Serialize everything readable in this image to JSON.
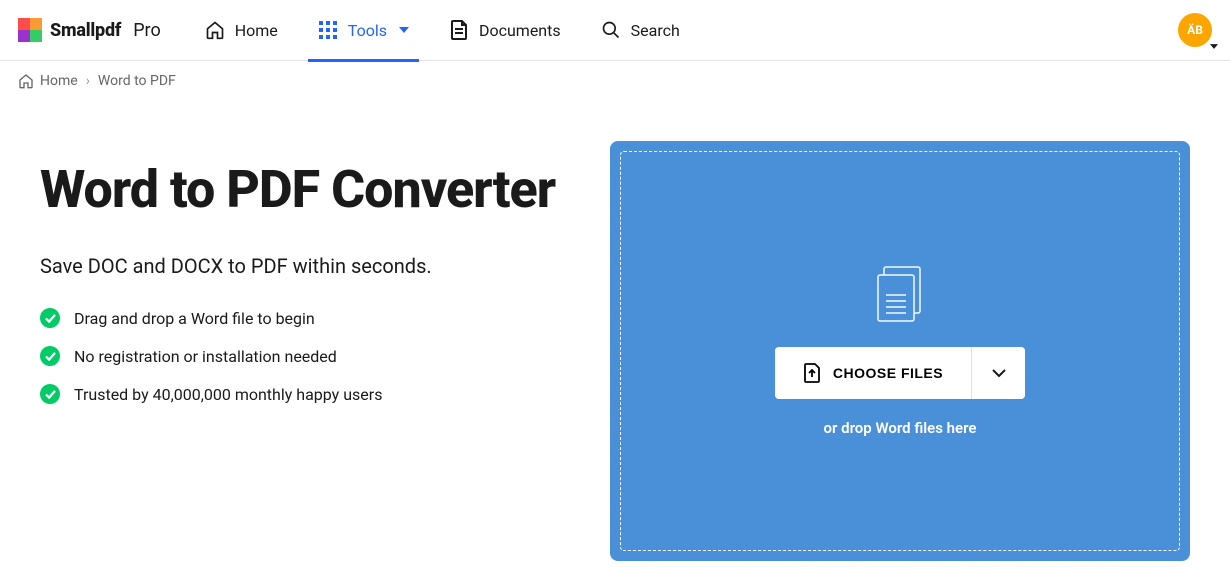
{
  "brand": {
    "name": "Smallpdf",
    "suffix": "Pro"
  },
  "nav": {
    "home": "Home",
    "tools": "Tools",
    "documents": "Documents",
    "search": "Search"
  },
  "avatar": {
    "initials": "ÄB"
  },
  "breadcrumb": {
    "home": "Home",
    "current": "Word to PDF"
  },
  "page": {
    "title": "Word to PDF Converter",
    "subtitle": "Save DOC and DOCX to PDF within seconds.",
    "bullets": [
      "Drag and drop a Word file to begin",
      "No registration or installation needed",
      "Trusted by 40,000,000 monthly happy users"
    ]
  },
  "drop": {
    "choose_label": "CHOOSE FILES",
    "hint": "or drop Word files here"
  }
}
